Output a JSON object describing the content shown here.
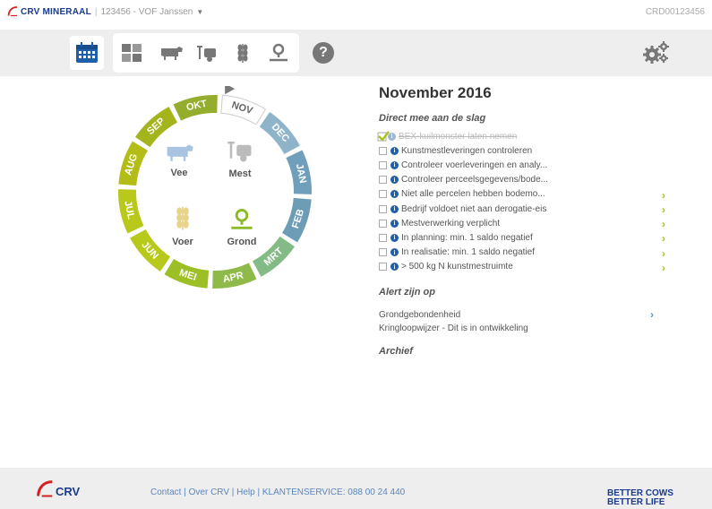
{
  "header": {
    "brand": "CRV MINERAAL",
    "separator": "|",
    "account": "123456 - VOF Janssen",
    "account_caret": "▼",
    "code": "CRD00123456"
  },
  "toolbar": {
    "items": [
      {
        "name": "calendar",
        "icon": "calendar-icon",
        "active": true
      },
      {
        "name": "plots",
        "icon": "plots-icon",
        "active": false
      },
      {
        "name": "cattle",
        "icon": "cow-icon",
        "active": false
      },
      {
        "name": "manure",
        "icon": "manure-icon",
        "active": false
      },
      {
        "name": "feed",
        "icon": "wheat-icon",
        "active": false
      },
      {
        "name": "land",
        "icon": "land-icon",
        "active": false
      },
      {
        "name": "help",
        "icon": "help-icon",
        "label": "?"
      }
    ],
    "settings_icon": "gears-icon"
  },
  "wheel": {
    "months": [
      "NOV",
      "DEC",
      "JAN",
      "FEB",
      "MRT",
      "APR",
      "MEI",
      "JUN",
      "JUL",
      "AUG",
      "SEP",
      "OKT"
    ],
    "current_month": "NOV",
    "buttons": [
      {
        "label": "Vee",
        "icon": "cow-icon"
      },
      {
        "label": "Mest",
        "icon": "manure-icon"
      },
      {
        "label": "Voer",
        "icon": "wheat-icon"
      },
      {
        "label": "Grond",
        "icon": "land-icon"
      }
    ]
  },
  "panel": {
    "title": "November 2016",
    "tasks_title": "Direct mee aan de slag",
    "tasks": [
      {
        "text": "BEX-kuilmonster laten nemen",
        "done": true,
        "arrow": false
      },
      {
        "text": "Kunstmestleveringen controleren",
        "done": false,
        "arrow": false
      },
      {
        "text": "Controleer voerleveringen en analy...",
        "done": false,
        "arrow": false
      },
      {
        "text": "Controleer perceelsgegevens/bode...",
        "done": false,
        "arrow": false
      },
      {
        "text": "Niet alle percelen hebben bodemo...",
        "done": false,
        "arrow": true
      },
      {
        "text": "Bedrijf voldoet niet aan derogatie-eis",
        "done": false,
        "arrow": true
      },
      {
        "text": "Mestverwerking verplicht",
        "done": false,
        "arrow": true
      },
      {
        "text": "In planning: min. 1 saldo negatief",
        "done": false,
        "arrow": true
      },
      {
        "text": "In realisatie: min. 1 saldo negatief",
        "done": false,
        "arrow": true
      },
      {
        "text": "> 500 kg N kunstmestruimte",
        "done": false,
        "arrow": true
      }
    ],
    "alerts_title": "Alert zijn op",
    "alerts": [
      {
        "text": "Grondgebondenheid",
        "arrow": true
      },
      {
        "text": "Kringloopwijzer - Dit is in ontwikkeling",
        "arrow": false
      }
    ],
    "archive_title": "Archief",
    "arrow_glyph": "›"
  },
  "footer": {
    "links": "Contact | Over CRV | Help | KLANTENSERVICE: 088 00 24 440",
    "logo": "CRV",
    "slogan_line1": "BETTER COWS",
    "slogan_line2": "BETTER LIFE"
  },
  "colors": {
    "brand_blue": "#1a3b8c",
    "accent_green": "#a9c21c",
    "info_blue": "#1e5faa",
    "link_blue": "#5a85bd"
  }
}
